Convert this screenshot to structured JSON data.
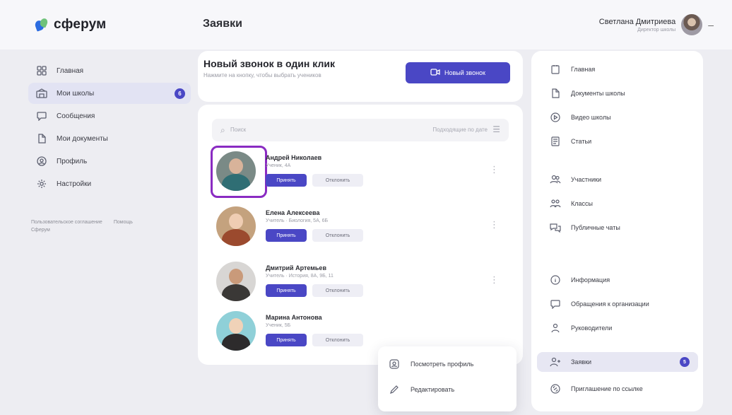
{
  "header": {
    "logo_text": "сферум",
    "page_title": "Заявки",
    "user_name": "Светлана Дмитриева",
    "user_role": "Директор школы"
  },
  "left_nav": {
    "items": [
      {
        "label": "Главная",
        "icon": "grid-icon",
        "active": false
      },
      {
        "label": "Мои школы",
        "icon": "school-icon",
        "active": true,
        "badge": "6"
      },
      {
        "label": "Сообщения",
        "icon": "chat-bubble-icon",
        "active": false
      },
      {
        "label": "Мои документы",
        "icon": "document-icon",
        "active": false
      },
      {
        "label": "Профиль",
        "icon": "profile-icon",
        "active": false
      },
      {
        "label": "Настройки",
        "icon": "gear-icon",
        "active": false
      }
    ],
    "footer_link_1": "Пользовательское соглашение",
    "footer_link_2": "Помощь",
    "footer_line_2": "Сферум"
  },
  "call_card": {
    "title": "Новый звонок в один клик",
    "subtitle": "Нажмите на кнопку, чтобы выбрать учеников",
    "button_label": "Новый звонок"
  },
  "requests": {
    "search_placeholder": "Поиск",
    "sort_label": "Подходящие по дате",
    "accept_label": "Принять",
    "reject_label": "Отклонить",
    "items": [
      {
        "name": "Андрей Николаев",
        "meta": "Ученик, 4А"
      },
      {
        "name": "Елена Алексеева",
        "meta": "Учитель · Биология, 5А, 6Б"
      },
      {
        "name": "Дмитрий Артемьев",
        "meta": "Учитель · История, 8А, 9Б, 11"
      },
      {
        "name": "Марина Антонова",
        "meta": "Ученик, 5Б"
      }
    ]
  },
  "dropdown": {
    "items": [
      {
        "label": "Посмотреть профиль",
        "icon": "view-profile-icon"
      },
      {
        "label": "Редактировать",
        "icon": "pencil-icon"
      }
    ]
  },
  "right_nav": {
    "items": [
      {
        "label": "Главная",
        "icon": "home-icon"
      },
      {
        "label": "Документы школы",
        "icon": "document-icon"
      },
      {
        "label": "Видео школы",
        "icon": "play-icon"
      },
      {
        "label": "Статьи",
        "icon": "articles-icon"
      },
      {
        "label": "Участники",
        "icon": "participants-icon"
      },
      {
        "label": "Классы",
        "icon": "classes-icon"
      },
      {
        "label": "Публичные чаты",
        "icon": "public-chats-icon"
      },
      {
        "label": "Информация",
        "icon": "info-icon"
      },
      {
        "label": "Обращения к организации",
        "icon": "appeals-icon"
      },
      {
        "label": "Руководители",
        "icon": "managers-icon"
      },
      {
        "label": "Заявки",
        "icon": "add-user-icon",
        "active": true,
        "badge": "5"
      },
      {
        "label": "Приглашение по ссылке",
        "icon": "invite-link-icon"
      }
    ]
  },
  "colors": {
    "accent": "#4a47c5",
    "highlight": "#8a2bc2",
    "background": "#ededf2"
  }
}
